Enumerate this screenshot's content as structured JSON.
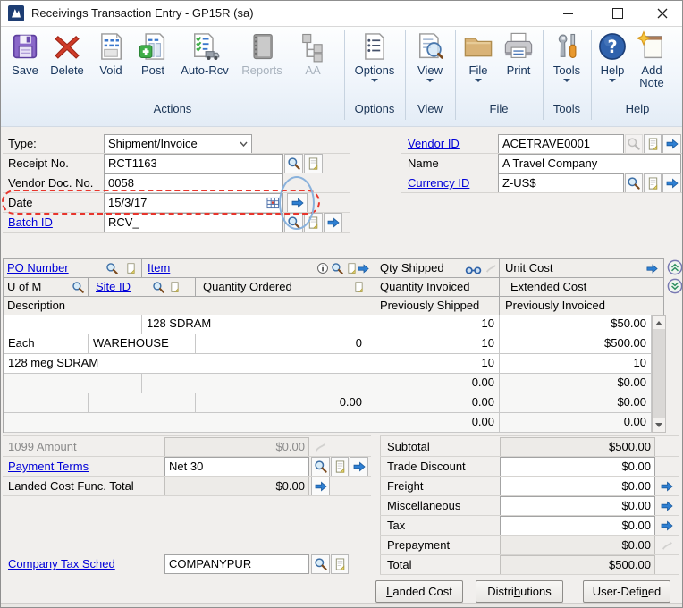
{
  "window": {
    "title": "Receivings Transaction Entry  -  GP15R (sa)"
  },
  "toolbar": {
    "actions": {
      "group_label": "Actions",
      "save": "Save",
      "delete": "Delete",
      "void": "Void",
      "post": "Post",
      "auto_rcv": "Auto-Rcv",
      "reports": "Reports",
      "aa": "AA"
    },
    "options": {
      "group_label": "Options",
      "options": "Options"
    },
    "view": {
      "group_label": "View",
      "view": "View"
    },
    "file": {
      "group_label": "File",
      "file": "File",
      "print": "Print"
    },
    "tools": {
      "group_label": "Tools",
      "tools": "Tools"
    },
    "help": {
      "group_label": "Help",
      "help": "Help",
      "add_note": "Add Note"
    }
  },
  "fields": {
    "type": {
      "label": "Type:",
      "value": "Shipment/Invoice"
    },
    "receipt_no": {
      "label": "Receipt No.",
      "value": "RCT1163"
    },
    "vendor_doc_no": {
      "label": "Vendor Doc. No.",
      "value": "0058"
    },
    "date": {
      "label": "Date",
      "value": "15/3/17"
    },
    "batch_id": {
      "label": "Batch ID",
      "value": "RCV_"
    },
    "vendor_id": {
      "label": "Vendor ID",
      "value": "ACETRAVE0001"
    },
    "name": {
      "label": "Name",
      "value": "A Travel Company"
    },
    "currency_id": {
      "label": "Currency ID",
      "value": "Z-US$"
    }
  },
  "grid": {
    "header": {
      "po_number": "PO Number",
      "item": "Item",
      "qty_shipped": "Qty Shipped",
      "unit_cost": "Unit Cost",
      "u_of_m": "U of M",
      "site_id": "Site ID",
      "quantity_ordered": "Quantity Ordered",
      "quantity_invoiced": "Quantity Invoiced",
      "extended_cost": "Extended Cost",
      "description": "Description",
      "previously_shipped": "Previously Shipped",
      "previously_invoiced": "Previously Invoiced"
    },
    "rows": [
      {
        "po_number": "",
        "item": "128 SDRAM",
        "qty_shipped": "10",
        "unit_cost": "$50.00",
        "u_of_m": "Each",
        "site_id": "WAREHOUSE",
        "quantity_ordered": "0",
        "quantity_invoiced": "10",
        "extended_cost": "$500.00",
        "description": "128 meg SDRAM",
        "previously_shipped": "10",
        "previously_invoiced": "10"
      },
      {
        "po_number": "",
        "item": "",
        "qty_shipped": "0.00",
        "unit_cost": "$0.00",
        "u_of_m": "",
        "site_id": "",
        "quantity_ordered": "0.00",
        "quantity_invoiced": "0.00",
        "extended_cost": "$0.00",
        "description": "",
        "previously_shipped": "0.00",
        "previously_invoiced": "0.00"
      }
    ]
  },
  "bottom": {
    "amount_1099": {
      "label": "1099 Amount",
      "value": "$0.00"
    },
    "payment_terms": {
      "label": "Payment Terms",
      "value": "Net 30"
    },
    "landed_cost_total": {
      "label": "Landed Cost Func. Total",
      "value": "$0.00"
    },
    "company_tax_sched": {
      "label": "Company Tax Sched",
      "value": "COMPANYPUR"
    },
    "subtotal": {
      "label": "Subtotal",
      "value": "$500.00"
    },
    "trade_discount": {
      "label": "Trade Discount",
      "value": "$0.00"
    },
    "freight": {
      "label": "Freight",
      "value": "$0.00"
    },
    "miscellaneous": {
      "label": "Miscellaneous",
      "value": "$0.00"
    },
    "tax": {
      "label": "Tax",
      "value": "$0.00"
    },
    "prepayment": {
      "label": "Prepayment",
      "value": "$0.00"
    },
    "total": {
      "label": "Total",
      "value": "$500.00"
    }
  },
  "buttons": {
    "landed_cost": {
      "pre": "",
      "u": "L",
      "post": "anded Cost"
    },
    "distributions": {
      "pre": "Distri",
      "u": "b",
      "post": "utions"
    },
    "user_defined": {
      "pre": "User-Defi",
      "u": "n",
      "post": "ed"
    }
  },
  "colors": {
    "link": "#0000d8",
    "expansion_arrow": "#2e7fd2",
    "annotation_red": "#e8352c",
    "annotation_blue": "#8ab2dc",
    "toolbar_label": "#17355c"
  }
}
